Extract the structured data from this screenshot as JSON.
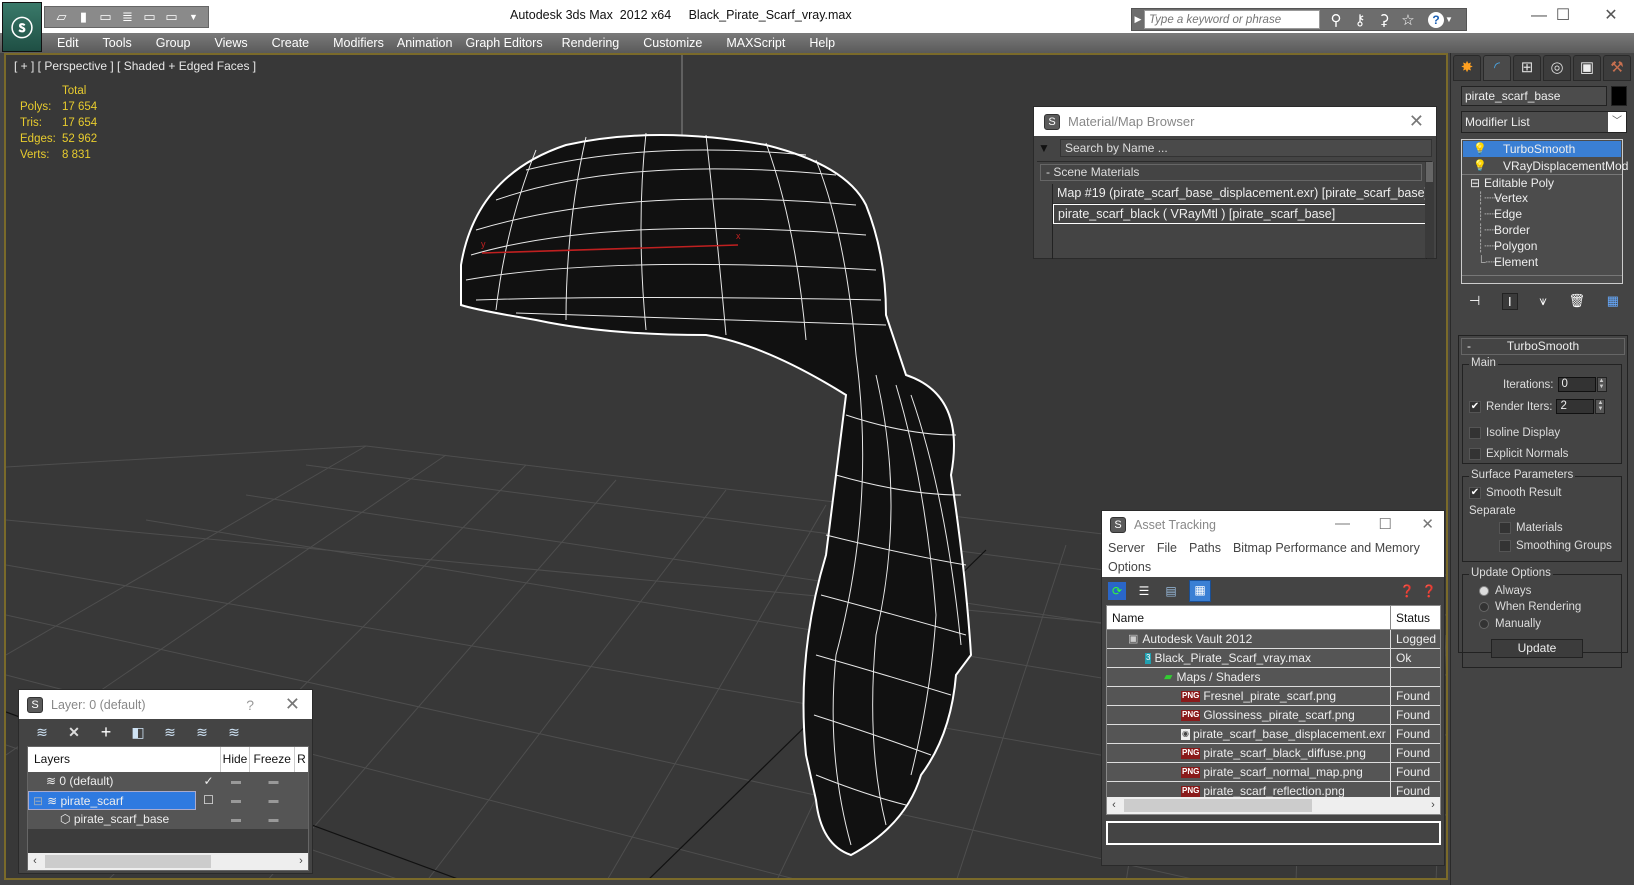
{
  "titlebar": {
    "app_title": "Autodesk 3ds Max  2012 x64",
    "file_name": "Black_Pirate_Scarf_vray.max",
    "search_placeholder": "Type a keyword or phrase",
    "quick_access": [
      "open-icon",
      "save-icon",
      "undo-icon",
      "project-icon",
      "redo-icon",
      "hold-icon",
      "dropdown-icon"
    ],
    "search_icons": [
      "binoculars-icon",
      "key-icon",
      "satellite-icon",
      "star-icon",
      "help-icon"
    ],
    "window_controls": {
      "minimize": "—",
      "maximize": "☐",
      "close": "✕"
    }
  },
  "menubar": {
    "items": [
      "Edit",
      "Tools",
      "Group",
      "Views",
      "Create",
      "Modifiers",
      "Animation",
      "Graph Editors",
      "Rendering",
      "Customize",
      "MAXScript",
      "Help"
    ]
  },
  "viewport": {
    "label": "[ + ] [ Perspective ] [ Shaded + Edged Faces ]",
    "stats_header": "Total",
    "stats": [
      {
        "key": "Polys:",
        "value": "17 654"
      },
      {
        "key": "Tris:",
        "value": "17 654"
      },
      {
        "key": "Edges:",
        "value": "52 962"
      },
      {
        "key": "Verts:",
        "value": "8 831"
      }
    ],
    "axis_x_label": "x",
    "axis_y_label": "y"
  },
  "material_browser": {
    "title": "Material/Map Browser",
    "search_placeholder": "Search by Name ...",
    "group_label": "- Scene Materials",
    "items": [
      "Map #19 (pirate_scarf_base_displacement.exr) [pirate_scarf_base]",
      "pirate_scarf_black  ( VRayMtl ) [pirate_scarf_base]"
    ],
    "selected_index": 1
  },
  "command_panel": {
    "tabs": [
      "create-icon",
      "modify-icon",
      "hierarchy-icon",
      "motion-icon",
      "display-icon",
      "utilities-icon"
    ],
    "object_name": "pirate_scarf_base",
    "object_color": "#000000",
    "modifier_list_label": "Modifier List",
    "stack": [
      {
        "label": "TurboSmooth",
        "selected": true,
        "bulb": true
      },
      {
        "label": "VRayDisplacementMod",
        "selected": false,
        "bulb": true
      },
      {
        "label": "Editable Poly",
        "selected": false,
        "bulb": false,
        "expander": "⊟"
      }
    ],
    "subobjects": [
      "Vertex",
      "Edge",
      "Border",
      "Polygon",
      "Element"
    ],
    "rollout": {
      "title": "TurboSmooth",
      "main_group": "Main",
      "iterations_label": "Iterations:",
      "iterations_value": "0",
      "render_iters_label": "Render Iters:",
      "render_iters_value": "2",
      "render_iters_checked": true,
      "isoline_label": "Isoline Display",
      "isoline_checked": false,
      "explicit_normals_label": "Explicit Normals",
      "explicit_normals_checked": false,
      "surface_group": "Surface Parameters",
      "smooth_result_label": "Smooth Result",
      "smooth_result_checked": true,
      "separate_label": "Separate",
      "materials_label": "Materials",
      "materials_checked": false,
      "smoothing_groups_label": "Smoothing Groups",
      "smoothing_groups_checked": false,
      "update_group": "Update Options",
      "update_options": [
        "Always",
        "When Rendering",
        "Manually"
      ],
      "update_selected": "Always",
      "update_button": "Update"
    }
  },
  "asset_tracking": {
    "title": "Asset Tracking",
    "menu": [
      "Server",
      "File",
      "Paths",
      "Bitmap Performance and Memory",
      "Options"
    ],
    "columns": [
      "Name",
      "Status"
    ],
    "rows": [
      {
        "name": "Autodesk Vault 2012",
        "status": "Logged O",
        "indent": 1,
        "icon": "vault-icon"
      },
      {
        "name": "Black_Pirate_Scarf_vray.max",
        "status": "Ok",
        "indent": 2,
        "icon": "max-file-icon"
      },
      {
        "name": "Maps / Shaders",
        "status": "",
        "indent": 3,
        "icon": "maps-icon"
      },
      {
        "name": "Fresnel_pirate_scarf.png",
        "status": "Found",
        "indent": 4,
        "icon": "png-icon"
      },
      {
        "name": "Glossiness_pirate_scarf.png",
        "status": "Found",
        "indent": 4,
        "icon": "png-icon"
      },
      {
        "name": "pirate_scarf_base_displacement.exr",
        "status": "Found",
        "indent": 4,
        "icon": "exr-icon"
      },
      {
        "name": "pirate_scarf_black_diffuse.png",
        "status": "Found",
        "indent": 4,
        "icon": "png-icon"
      },
      {
        "name": "pirate_scarf_normal_map.png",
        "status": "Found",
        "indent": 4,
        "icon": "png-icon"
      },
      {
        "name": "pirate_scarf_reflection.png",
        "status": "Found",
        "indent": 4,
        "icon": "png-icon"
      }
    ]
  },
  "layer_dialog": {
    "title": "Layer: 0 (default)",
    "help": "?",
    "columns": [
      "Layers",
      "",
      "Hide",
      "Freeze",
      "R"
    ],
    "rows": [
      {
        "name": "0 (default)",
        "check": "✓",
        "indent": 1,
        "selected": false,
        "icon": "layer-icon"
      },
      {
        "name": "pirate_scarf",
        "check": "☐",
        "indent": 1,
        "selected": true,
        "icon": "layer-icon",
        "expander": "⊟"
      },
      {
        "name": "pirate_scarf_base",
        "check": "",
        "indent": 2,
        "selected": false,
        "icon": "object-icon"
      }
    ]
  }
}
